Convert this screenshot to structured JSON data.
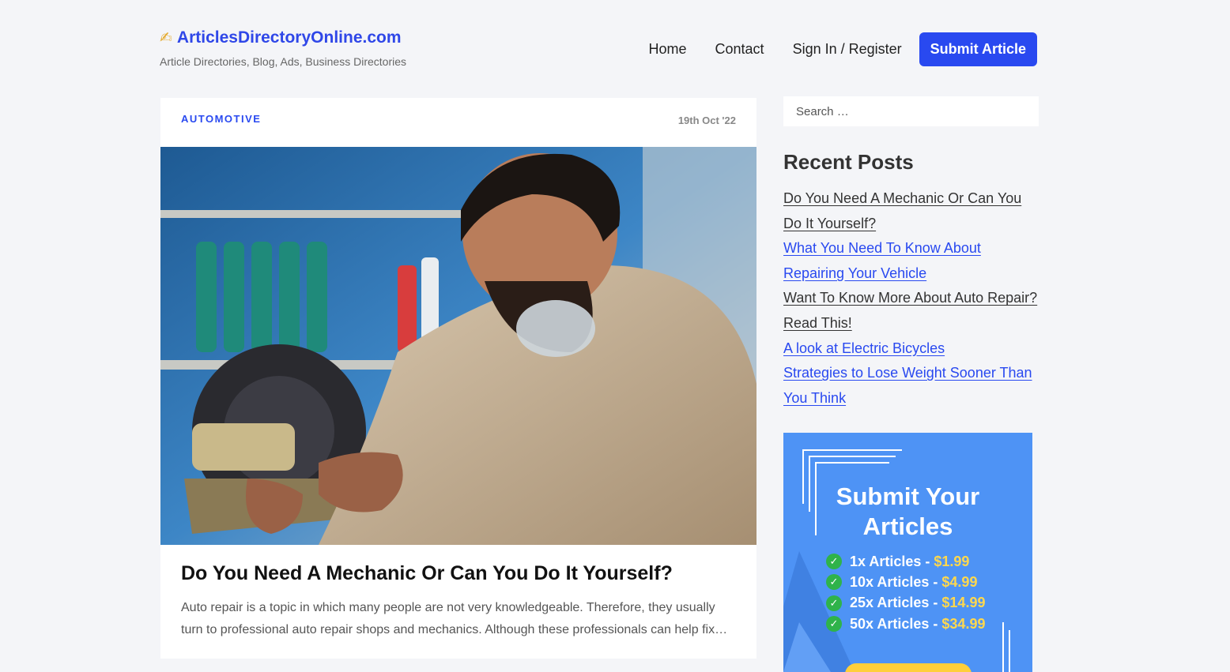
{
  "header": {
    "brand_name": "ArticlesDirectoryOnline.com",
    "brand_icon": "writing-hand-icon",
    "tagline": "Article Directories, Blog, Ads, Business Directories",
    "nav": {
      "home": "Home",
      "contact": "Contact",
      "signin": "Sign In / Register",
      "submit": "Submit Article"
    }
  },
  "post": {
    "category": "AUTOMOTIVE",
    "date": "19th Oct '22",
    "title": "Do You Need A Mechanic Or Can You Do It Yourself?",
    "excerpt": "Auto repair is a topic in which many people are not very knowledgeable. Therefore, they usually turn to professional auto repair shops and mechanics. Although these professionals can help fix…"
  },
  "sidebar": {
    "search_placeholder": "Search …",
    "recent_heading": "Recent Posts",
    "recent": [
      "Do You Need A Mechanic Or Can You Do It Yourself?",
      "What You Need To Know About Repairing Your Vehicle",
      "Want To Know More About Auto Repair? Read This!",
      "A look at Electric Bicycles",
      "Strategies to Lose Weight Sooner Than You Think"
    ],
    "ad": {
      "title_line1": "Submit Your",
      "title_line2": "Articles",
      "rows": [
        {
          "label": "1x Articles -",
          "price": "$1.99"
        },
        {
          "label": "10x Articles -",
          "price": "$4.99"
        },
        {
          "label": "25x Articles -",
          "price": "$14.99"
        },
        {
          "label": "50x Articles -",
          "price": "$34.99"
        }
      ]
    }
  },
  "colors": {
    "accent": "#2949f0",
    "background": "#f4f5f8",
    "ad_background": "#4e93f5",
    "ad_price": "#ffd84d",
    "check": "#2fb34a"
  }
}
